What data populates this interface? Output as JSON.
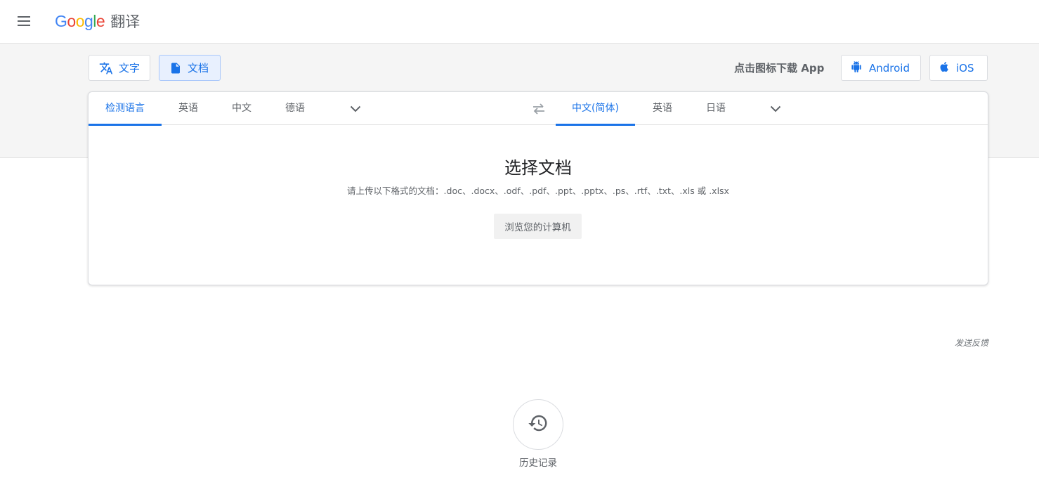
{
  "header": {
    "logo_text": "Google",
    "product_name": "翻译"
  },
  "modes": [
    {
      "label": "文字",
      "active": false
    },
    {
      "label": "文档",
      "active": true
    }
  ],
  "app_download": {
    "label": "点击图标下载 App",
    "android_label": "Android",
    "ios_label": "iOS"
  },
  "source_languages": [
    {
      "label": "检测语言",
      "active": true
    },
    {
      "label": "英语",
      "active": false
    },
    {
      "label": "中文",
      "active": false
    },
    {
      "label": "德语",
      "active": false
    }
  ],
  "target_languages": [
    {
      "label": "中文(简体)",
      "active": true
    },
    {
      "label": "英语",
      "active": false
    },
    {
      "label": "日语",
      "active": false
    }
  ],
  "document": {
    "title": "选择文档",
    "hint": "请上传以下格式的文档：.doc、.docx、.odf、.pdf、.ppt、.pptx、.ps、.rtf、.txt、.xls 或 .xlsx",
    "browse_label": "浏览您的计算机"
  },
  "feedback_label": "发送反馈",
  "history_label": "历史记录",
  "colors": {
    "accent": "#1a73e8",
    "band": "#f5f5f5",
    "text_secondary": "#5f6368"
  },
  "icons": {
    "menu": "menu-icon",
    "text_mode": "translate-icon",
    "doc_mode": "document-icon",
    "android": "android-icon",
    "ios": "apple-icon",
    "swap": "swap-icon",
    "expand": "chevron-down-icon",
    "history": "history-icon"
  }
}
